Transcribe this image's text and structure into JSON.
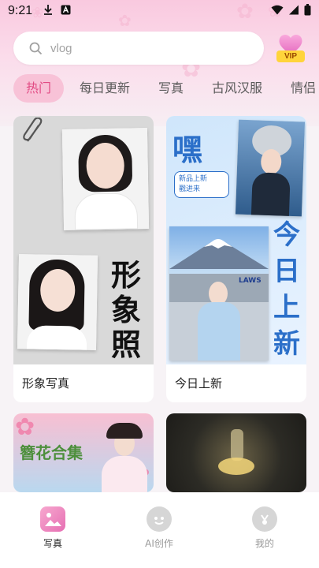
{
  "status_bar": {
    "time": "9:21"
  },
  "search": {
    "placeholder": "vlog"
  },
  "vip_badge": {
    "label": "VIP"
  },
  "tabs": [
    {
      "label": "热门",
      "active": true
    },
    {
      "label": "每日更新",
      "active": false
    },
    {
      "label": "写真",
      "active": false
    },
    {
      "label": "古风汉服",
      "active": false
    },
    {
      "label": "情侣",
      "active": false
    }
  ],
  "cards": [
    {
      "title": "形象写真",
      "art_text": [
        "形",
        "象",
        "照"
      ]
    },
    {
      "title": "今日上新",
      "art_text": {
        "hey": "嘿",
        "bubble": "新品上新\n戳进来",
        "vertical": [
          "今",
          "日",
          "上",
          "新"
        ],
        "sign": "LAWS"
      }
    },
    {
      "title": "",
      "art_text": "簪花合集"
    },
    {
      "title": ""
    }
  ],
  "nav": {
    "items": [
      {
        "label": "写真",
        "active": true
      },
      {
        "label": "AI创作",
        "active": false
      },
      {
        "label": "我的",
        "active": false
      }
    ]
  },
  "colors": {
    "accent": "#e24b84",
    "tab_active_bg": "#f8c2d7",
    "vip": "#ffd43b"
  }
}
